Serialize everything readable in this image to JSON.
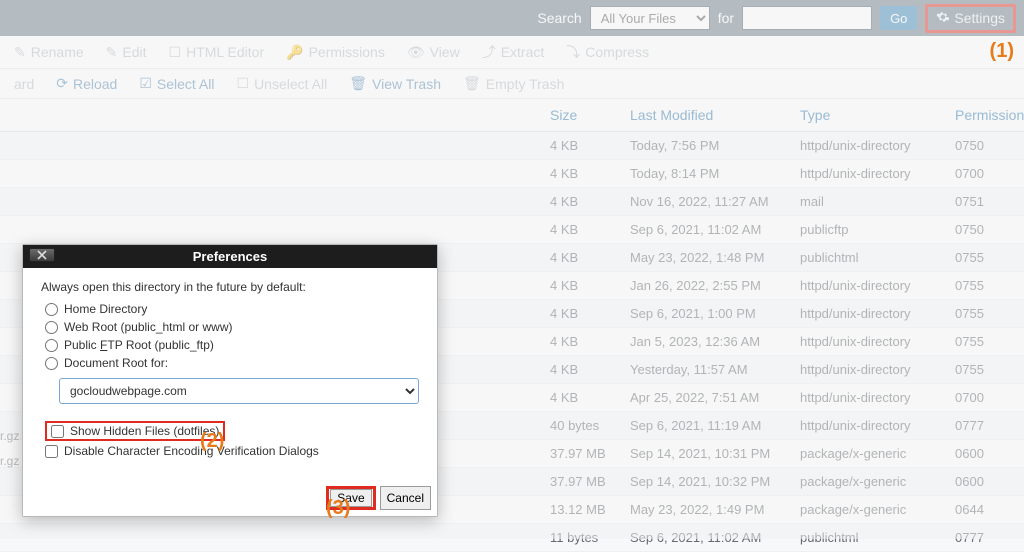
{
  "topbar": {
    "search_label": "Search",
    "scope_selected": "All Your Files",
    "for_label": "for",
    "search_value": "",
    "go_label": "Go",
    "settings_label": "Settings"
  },
  "toolbar_a": {
    "rename": "Rename",
    "edit": "Edit",
    "html_editor": "HTML Editor",
    "permissions": "Permissions",
    "view": "View",
    "extract": "Extract",
    "compress": "Compress"
  },
  "toolbar_b": {
    "ard": "ard",
    "reload": "Reload",
    "select_all": "Select All",
    "unselect_all": "Unselect All",
    "view_trash": "View Trash",
    "empty_trash": "Empty Trash"
  },
  "table": {
    "headers": {
      "size": "Size",
      "modified": "Last Modified",
      "type": "Type",
      "perm": "Permissions"
    },
    "rows": [
      {
        "size": "4 KB",
        "modified": "Today, 7:56 PM",
        "type": "httpd/unix-directory",
        "perm": "0750"
      },
      {
        "size": "4 KB",
        "modified": "Today, 8:14 PM",
        "type": "httpd/unix-directory",
        "perm": "0700"
      },
      {
        "size": "4 KB",
        "modified": "Nov 16, 2022, 11:27 AM",
        "type": "mail",
        "perm": "0751"
      },
      {
        "size": "4 KB",
        "modified": "Sep 6, 2021, 11:02 AM",
        "type": "publicftp",
        "perm": "0750"
      },
      {
        "size": "4 KB",
        "modified": "May 23, 2022, 1:48 PM",
        "type": "publichtml",
        "perm": "0755"
      },
      {
        "size": "4 KB",
        "modified": "Jan 26, 2022, 2:55 PM",
        "type": "httpd/unix-directory",
        "perm": "0755"
      },
      {
        "size": "4 KB",
        "modified": "Sep 6, 2021, 1:00 PM",
        "type": "httpd/unix-directory",
        "perm": "0755"
      },
      {
        "size": "4 KB",
        "modified": "Jan 5, 2023, 12:36 AM",
        "type": "httpd/unix-directory",
        "perm": "0755"
      },
      {
        "size": "4 KB",
        "modified": "Yesterday, 11:57 AM",
        "type": "httpd/unix-directory",
        "perm": "0755"
      },
      {
        "size": "4 KB",
        "modified": "Apr 25, 2022, 7:51 AM",
        "type": "httpd/unix-directory",
        "perm": "0700"
      },
      {
        "size": "40 bytes",
        "modified": "Sep 6, 2021, 11:19 AM",
        "type": "httpd/unix-directory",
        "perm": "0777"
      },
      {
        "size": "37.97 MB",
        "modified": "Sep 14, 2021, 10:31 PM",
        "type": "package/x-generic",
        "perm": "0600"
      },
      {
        "size": "37.97 MB",
        "modified": "Sep 14, 2021, 10:32 PM",
        "type": "package/x-generic",
        "perm": "0600"
      },
      {
        "size": "13.12 MB",
        "modified": "May 23, 2022, 1:49 PM",
        "type": "package/x-generic",
        "perm": "0644"
      },
      {
        "size": "11 bytes",
        "modified": "Sep 6, 2021, 11:02 AM",
        "type": "publichtml",
        "perm": "0777"
      }
    ]
  },
  "left_fragments": {
    "a": "r.gz",
    "b": "r.gz"
  },
  "modal": {
    "title": "Preferences",
    "prompt": "Always open this directory in the future by default:",
    "opt_home": "Home Directory",
    "opt_webroot": "Web Root (public_html or www)",
    "opt_ftp_prefix": "Public ",
    "opt_ftp_key": "F",
    "opt_ftp_suffix": "TP Root (public_ftp)",
    "opt_docroot": "Document Root for:",
    "domain": "gocloudwebpage.com",
    "chk_hidden": "Show Hidden Files (dotfiles)",
    "chk_encoding": "Disable Character Encoding Verification Dialogs",
    "save": "Save",
    "cancel": "Cancel"
  },
  "annotations": {
    "one": "(1)",
    "two": "(2)",
    "three": "(3)"
  }
}
